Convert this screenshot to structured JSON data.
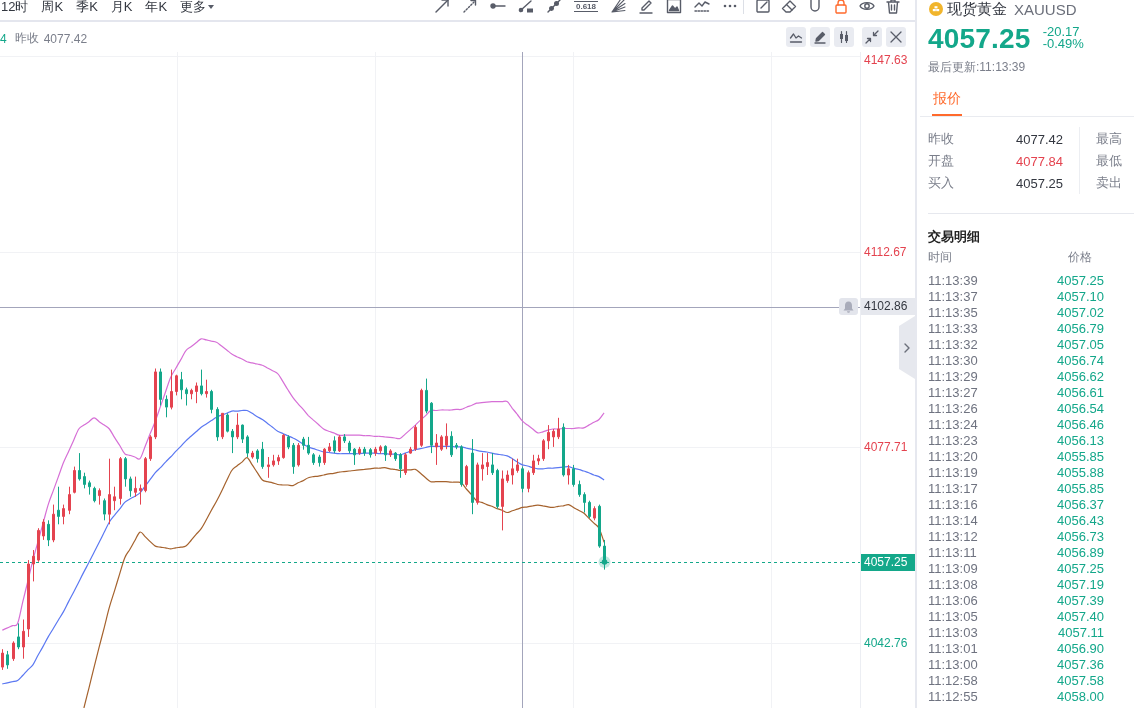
{
  "toolbar": {
    "intervals": [
      {
        "label": "12时",
        "selected": false,
        "kind": "interval"
      },
      {
        "label": "周K",
        "selected": false,
        "kind": "interval"
      },
      {
        "label": "季K",
        "selected": false,
        "kind": "interval"
      },
      {
        "label": "月K",
        "selected": false,
        "kind": "interval"
      },
      {
        "label": "年K",
        "selected": false,
        "kind": "interval"
      },
      {
        "label": "更多",
        "selected": false,
        "kind": "dropdown"
      }
    ],
    "fib_label": "0.618",
    "lock_on": true
  },
  "chart": {
    "legend": {
      "cut_value": "4",
      "prev_close_label": "昨收",
      "prev_close_value": "4077.42"
    },
    "chart_data": [
      {
        "type": "candlestick",
        "ylim": [
          4031.2,
          4148.3
        ],
        "yticks": [
          {
            "value": 4042.76,
            "label": "4042.76"
          },
          {
            "value": 4077.71,
            "label": "4077.71"
          },
          {
            "value": 4112.67,
            "label": "4112.67"
          },
          {
            "value": 4147.63,
            "label": "4147.63"
          }
        ],
        "tick_labels": "y",
        "grid": true,
        "categories": [
          null,
          null,
          null,
          null,
          null,
          null,
          null,
          null,
          null,
          null,
          null,
          null,
          null,
          null,
          null,
          null,
          null,
          null,
          null,
          null,
          null,
          null,
          null,
          null,
          null,
          null,
          null,
          null,
          null,
          null,
          null,
          null,
          null,
          null,
          null,
          null,
          null,
          null,
          null,
          null,
          null,
          null,
          null,
          null,
          null,
          null,
          null,
          null,
          null,
          null,
          null,
          null,
          null,
          null,
          null,
          null,
          null,
          null,
          null,
          null,
          null,
          null,
          null,
          null,
          null,
          null,
          null,
          null,
          null,
          null,
          null,
          null,
          null,
          null,
          null,
          null,
          null,
          null,
          null,
          null,
          null,
          null,
          null,
          null,
          null,
          null,
          null,
          null,
          null,
          null,
          null,
          null,
          null,
          null,
          null,
          null,
          null,
          null,
          null,
          null,
          null,
          null,
          null,
          null,
          null,
          null,
          null,
          null,
          null,
          null,
          null,
          null,
          null,
          null,
          null,
          null,
          null,
          null,
          null
        ],
        "ohlc": [
          [
            4038.5,
            4041.7,
            4038.0,
            4041.0
          ],
          [
            4040.7,
            4041.4,
            4038.2,
            4038.9
          ],
          [
            4040.0,
            4043.1,
            4039.6,
            4042.8
          ],
          [
            4043.9,
            4046.3,
            4041.7,
            4042.1
          ],
          [
            4042.1,
            4047.0,
            4040.0,
            4044.9
          ],
          [
            4045.3,
            4057.6,
            4043.9,
            4056.9
          ],
          [
            4056.9,
            4059.4,
            4053.8,
            4058.3
          ],
          [
            4057.6,
            4063.3,
            4057.3,
            4062.9
          ],
          [
            4061.9,
            4064.9,
            4061.2,
            4064.4
          ],
          [
            4064.0,
            4064.7,
            4060.1,
            4061.2
          ],
          [
            4061.2,
            4067.5,
            4060.8,
            4065.8
          ],
          [
            4066.5,
            4070.7,
            4064.0,
            4065.4
          ],
          [
            4065.4,
            4067.5,
            4064.0,
            4066.8
          ],
          [
            4066.5,
            4070.7,
            4065.8,
            4069.3
          ],
          [
            4069.7,
            4074.3,
            4069.5,
            4073.6
          ],
          [
            4073.6,
            4076.7,
            4071.8,
            4072.1
          ],
          [
            4072.5,
            4073.2,
            4070.4,
            4071.1
          ],
          [
            4071.4,
            4071.8,
            4069.3,
            4070.7
          ],
          [
            4070.4,
            4070.7,
            4067.9,
            4068.2
          ],
          [
            4069.1,
            4070.4,
            4067.5,
            4070.0
          ],
          [
            4068.2,
            4068.6,
            4064.7,
            4065.8
          ],
          [
            4065.8,
            4075.7,
            4064.0,
            4069.3
          ],
          [
            4068.2,
            4070.7,
            4066.5,
            4068.9
          ],
          [
            4068.6,
            4076.0,
            4067.5,
            4075.7
          ],
          [
            4075.7,
            4076.0,
            4070.7,
            4072.1
          ],
          [
            4072.1,
            4072.5,
            4068.9,
            4070.0
          ],
          [
            4069.7,
            4072.5,
            4068.9,
            4070.4
          ],
          [
            4070.0,
            4071.1,
            4067.5,
            4070.4
          ],
          [
            4070.0,
            4076.0,
            4069.7,
            4075.7
          ],
          [
            4075.7,
            4079.9,
            4075.3,
            4079.6
          ],
          [
            4079.6,
            4091.8,
            4079.2,
            4091.2
          ],
          [
            4091.2,
            4091.8,
            4085.2,
            4086.3
          ],
          [
            4086.3,
            4087.0,
            4083.1,
            4084.9
          ],
          [
            4084.9,
            4091.6,
            4084.5,
            4087.7
          ],
          [
            4087.7,
            4090.7,
            4087.0,
            4090.5
          ],
          [
            4089.8,
            4091.2,
            4086.3,
            4088.0
          ],
          [
            4088.0,
            4088.4,
            4085.2,
            4087.3
          ],
          [
            4087.3,
            4088.2,
            4086.3,
            4087.9
          ],
          [
            4087.7,
            4089.3,
            4085.6,
            4088.7
          ],
          [
            4088.7,
            4091.6,
            4087.0,
            4087.3
          ],
          [
            4087.3,
            4089.8,
            4086.6,
            4087.7
          ],
          [
            4087.7,
            4088.0,
            4083.8,
            4084.5
          ],
          [
            4084.5,
            4084.9,
            4078.9,
            4079.6
          ],
          [
            4079.6,
            4083.8,
            4079.2,
            4083.8
          ],
          [
            4083.5,
            4083.8,
            4080.4,
            4080.6
          ],
          [
            4080.6,
            4081.0,
            4076.7,
            4079.6
          ],
          [
            4079.6,
            4083.8,
            4079.2,
            4081.7
          ],
          [
            4081.7,
            4081.8,
            4078.5,
            4079.2
          ],
          [
            4079.6,
            4079.9,
            4076.0,
            4076.7
          ],
          [
            4076.0,
            4077.1,
            4075.7,
            4076.7
          ],
          [
            4077.1,
            4077.4,
            4075.0,
            4075.7
          ],
          [
            4077.4,
            4078.7,
            4073.9,
            4074.3
          ],
          [
            4074.3,
            4076.0,
            4072.3,
            4074.6
          ],
          [
            4074.6,
            4076.4,
            4074.3,
            4075.3
          ],
          [
            4075.3,
            4076.4,
            4074.6,
            4075.9
          ],
          [
            4075.9,
            4080.1,
            4075.7,
            4079.9
          ],
          [
            4079.6,
            4079.9,
            4077.4,
            4077.8
          ],
          [
            4078.1,
            4078.5,
            4073.0,
            4074.3
          ],
          [
            4074.6,
            4078.5,
            4074.3,
            4078.1
          ],
          [
            4079.2,
            4079.6,
            4077.3,
            4078.1
          ],
          [
            4078.1,
            4079.6,
            4076.4,
            4076.7
          ],
          [
            4076.4,
            4076.7,
            4074.6,
            4075.0
          ],
          [
            4076.0,
            4076.4,
            4074.3,
            4075.0
          ],
          [
            4075.0,
            4077.6,
            4074.6,
            4077.4
          ],
          [
            4077.1,
            4078.5,
            4076.9,
            4077.8
          ],
          [
            4078.9,
            4079.7,
            4076.7,
            4077.1
          ],
          [
            4077.1,
            4079.9,
            4076.9,
            4079.6
          ],
          [
            4079.6,
            4080.1,
            4078.5,
            4078.9
          ],
          [
            4078.5,
            4078.9,
            4076.7,
            4077.1
          ],
          [
            4077.4,
            4077.6,
            4074.6,
            4076.4
          ],
          [
            4076.7,
            4077.8,
            4076.4,
            4077.4
          ],
          [
            4077.4,
            4077.8,
            4076.2,
            4076.7
          ],
          [
            4077.3,
            4077.6,
            4075.9,
            4076.4
          ],
          [
            4076.7,
            4077.8,
            4076.2,
            4077.4
          ],
          [
            4077.1,
            4078.1,
            4076.6,
            4077.8
          ],
          [
            4077.9,
            4078.1,
            4075.3,
            4076.4
          ],
          [
            4076.4,
            4077.4,
            4076.0,
            4077.1
          ],
          [
            4076.7,
            4076.9,
            4075.3,
            4075.7
          ],
          [
            4076.4,
            4076.7,
            4072.3,
            4073.9
          ],
          [
            4073.2,
            4076.7,
            4072.8,
            4076.4
          ],
          [
            4076.7,
            4077.8,
            4076.6,
            4077.4
          ],
          [
            4077.4,
            4081.7,
            4077.1,
            4081.3
          ],
          [
            4078.1,
            4088.2,
            4077.8,
            4087.9
          ],
          [
            4087.9,
            4090.0,
            4083.8,
            4084.2
          ],
          [
            4085.6,
            4085.8,
            4076.7,
            4078.1
          ],
          [
            4077.8,
            4080.1,
            4074.6,
            4078.5
          ],
          [
            4077.4,
            4079.9,
            4077.1,
            4079.6
          ],
          [
            4078.1,
            4082.0,
            4077.4,
            4079.7
          ],
          [
            4079.7,
            4080.6,
            4076.0,
            4076.4
          ],
          [
            4078.1,
            4078.5,
            4077.4,
            4077.8
          ],
          [
            4077.8,
            4078.1,
            4070.7,
            4071.1
          ],
          [
            4071.1,
            4074.6,
            4070.7,
            4074.3
          ],
          [
            4076.7,
            4079.2,
            4065.8,
            4067.9
          ],
          [
            4067.9,
            4075.0,
            4067.5,
            4074.6
          ],
          [
            4073.9,
            4076.7,
            4071.8,
            4074.6
          ],
          [
            4074.3,
            4076.7,
            4072.8,
            4075.0
          ],
          [
            4074.6,
            4076.7,
            4072.8,
            4073.2
          ],
          [
            4073.6,
            4073.9,
            4066.8,
            4067.2
          ],
          [
            4067.2,
            4073.6,
            4062.9,
            4072.1
          ],
          [
            4071.8,
            4073.6,
            4071.4,
            4072.8
          ],
          [
            4072.8,
            4075.7,
            4071.1,
            4073.9
          ],
          [
            4073.6,
            4075.7,
            4073.2,
            4074.6
          ],
          [
            4073.9,
            4074.3,
            4069.7,
            4070.4
          ],
          [
            4070.4,
            4073.6,
            4069.7,
            4073.2
          ],
          [
            4073.2,
            4076.4,
            4072.8,
            4075.3
          ],
          [
            4075.3,
            4076.4,
            4074.6,
            4075.7
          ],
          [
            4075.7,
            4079.2,
            4075.3,
            4078.9
          ],
          [
            4078.9,
            4081.7,
            4077.4,
            4080.4
          ],
          [
            4079.6,
            4081.0,
            4077.8,
            4080.6
          ],
          [
            4079.6,
            4083.0,
            4079.2,
            4081.0
          ],
          [
            4081.3,
            4082.0,
            4072.5,
            4072.8
          ],
          [
            4072.8,
            4074.6,
            4071.1,
            4073.9
          ],
          [
            4073.9,
            4074.6,
            4070.7,
            4071.1
          ],
          [
            4071.1,
            4071.8,
            4068.9,
            4069.3
          ],
          [
            4069.3,
            4069.7,
            4066.1,
            4067.9
          ],
          [
            4067.9,
            4068.2,
            4065.1,
            4065.4
          ],
          [
            4065.1,
            4067.2,
            4064.7,
            4066.8
          ],
          [
            4067.2,
            4067.5,
            4059.8,
            4060.1
          ],
          [
            4060.1,
            4061.2,
            4055.9,
            4057.25
          ]
        ],
        "series": [
          {
            "type": "line",
            "color": "#d66fd6",
            "values": [
              4045.1,
              4045.5,
              4045.9,
              4046.3,
              4050.1,
              4053.8,
              4057.6,
              4060.9,
              4064.2,
              4067.5,
              4070.0,
              4072.5,
              4075.0,
              4077.0,
              4079.0,
              4081.0,
              4081.7,
              4082.3,
              4083.0,
              4082.3,
              4081.7,
              4081.0,
              4079.5,
              4078.1,
              4076.6,
              4076.3,
              4076.0,
              4075.7,
              4077.9,
              4080.2,
              4082.4,
              4085.0,
              4087.6,
              4090.2,
              4091.8,
              4093.4,
              4095.0,
              4095.7,
              4096.4,
              4097.1,
              4096.9,
              4096.7,
              4096.5,
              4095.8,
              4095.1,
              4094.4,
              4093.9,
              4093.5,
              4093.0,
              4092.8,
              4092.6,
              4092.4,
              4091.9,
              4091.4,
              4090.9,
              4089.5,
              4088.0,
              4086.6,
              4085.5,
              4084.5,
              4083.4,
              4082.6,
              4081.8,
              4081.0,
              4080.6,
              4080.3,
              4079.9,
              4079.9,
              4079.9,
              4079.9,
              4079.9,
              4079.8,
              4079.8,
              4079.7,
              4079.7,
              4079.6,
              4079.5,
              4079.4,
              4079.3,
              4080.1,
              4080.9,
              4081.7,
              4082.6,
              4083.4,
              4084.3,
              4084.3,
              4084.4,
              4084.4,
              4084.4,
              4084.5,
              4084.5,
              4084.9,
              4085.2,
              4085.6,
              4085.7,
              4085.8,
              4085.9,
              4085.9,
              4085.9,
              4085.9,
              4084.7,
              4083.6,
              4082.4,
              4081.7,
              4081.0,
              4080.3,
              4080.5,
              4080.8,
              4081.0,
              4081.0,
              4081.1,
              4081.1,
              4081.1,
              4081.2,
              4081.2,
              4081.7,
              4082.2,
              4082.7,
              4083.9
            ]
          },
          {
            "type": "line",
            "color": "#5b78f2",
            "values": [
              4035.5,
              4035.7,
              4035.9,
              4036.1,
              4037.0,
              4038.0,
              4038.9,
              4040.6,
              4042.2,
              4043.9,
              4045.4,
              4046.9,
              4048.4,
              4050.2,
              4051.9,
              4053.7,
              4055.5,
              4057.2,
              4059.0,
              4060.8,
              4062.6,
              4064.4,
              4065.6,
              4066.7,
              4067.9,
              4068.5,
              4069.0,
              4069.6,
              4070.8,
              4072.0,
              4073.2,
              4074.1,
              4075.1,
              4076.0,
              4077.0,
              4077.9,
              4078.9,
              4079.7,
              4080.5,
              4081.3,
              4081.9,
              4082.5,
              4083.1,
              4083.5,
              4083.8,
              4084.2,
              4084.2,
              4084.3,
              4084.3,
              4083.8,
              4083.2,
              4082.7,
              4082.0,
              4081.3,
              4080.6,
              4080.2,
              4079.8,
              4079.4,
              4078.9,
              4078.3,
              4077.8,
              4077.5,
              4077.2,
              4076.9,
              4076.8,
              4076.7,
              4076.6,
              4076.6,
              4076.6,
              4076.6,
              4076.6,
              4076.7,
              4076.7,
              4076.7,
              4076.6,
              4076.6,
              4076.5,
              4076.5,
              4076.4,
              4076.7,
              4077.0,
              4077.3,
              4077.5,
              4077.7,
              4077.9,
              4077.9,
              4077.9,
              4077.9,
              4077.9,
              4077.8,
              4077.8,
              4077.6,
              4077.4,
              4077.2,
              4077.0,
              4076.9,
              4076.7,
              4076.5,
              4076.4,
              4076.2,
              4075.7,
              4075.1,
              4074.6,
              4074.4,
              4074.1,
              4073.9,
              4073.9,
              4074.0,
              4074.0,
              4074.1,
              4074.2,
              4074.3,
              4074.0,
              4073.8,
              4073.5,
              4073.2,
              4072.8,
              4072.5,
              4071.9
            ]
          },
          {
            "type": "line",
            "color": "#a5622d",
            "values": [
              null,
              null,
              null,
              null,
              null,
              null,
              null,
              null,
              null,
              null,
              null,
              null,
              null,
              null,
              null,
              null,
              4031.2,
              4034.8,
              4038.5,
              4042.1,
              4045.6,
              4049.2,
              4052.1,
              4055.1,
              4058.0,
              4059.5,
              4061.1,
              4062.6,
              4061.8,
              4060.9,
              4060.1,
              4059.9,
              4059.8,
              4059.6,
              4059.8,
              4059.9,
              4060.1,
              4061.1,
              4062.2,
              4063.2,
              4064.8,
              4066.5,
              4068.1,
              4069.9,
              4071.8,
              4073.6,
              4074.4,
              4075.1,
              4075.9,
              4074.6,
              4073.2,
              4071.9,
              4071.6,
              4071.4,
              4071.1,
              4071.0,
              4071.0,
              4070.9,
              4071.4,
              4071.8,
              4072.3,
              4072.5,
              4072.6,
              4072.8,
              4073.0,
              4073.1,
              4073.3,
              4073.4,
              4073.5,
              4073.6,
              4073.7,
              4073.8,
              4073.9,
              4074.0,
              4074.0,
              4074.1,
              4073.9,
              4073.8,
              4073.6,
              4073.7,
              4073.7,
              4073.8,
              4073.1,
              4072.3,
              4071.6,
              4071.6,
              4071.6,
              4071.6,
              4071.5,
              4071.5,
              4071.4,
              4070.3,
              4069.3,
              4068.2,
              4067.9,
              4067.5,
              4067.2,
              4066.8,
              4066.5,
              4066.1,
              4066.4,
              4066.7,
              4067.0,
              4067.1,
              4067.3,
              4067.4,
              4067.3,
              4067.1,
              4067.0,
              4067.2,
              4067.3,
              4067.5,
              4067.0,
              4066.5,
              4066.0,
              4065.1,
              4064.2,
              4063.3,
              4060.8
            ]
          }
        ],
        "ref_lines": [
          {
            "axis": "y",
            "value": 4102.86,
            "label": "4102.86",
            "color": "#a3a5bb",
            "line_style": "solid"
          },
          {
            "axis": "y",
            "value": 4057.25,
            "label": "4057.25",
            "color": "#14a88a",
            "line_style": "dashed"
          }
        ]
      }
    ]
  },
  "quote_panel": {
    "name": "现货黄金",
    "symbol": "XAUUSD",
    "price": "4057.25",
    "change": "-20.17",
    "change_pct": "-0.49%",
    "updated": "最后更新:11:13:39",
    "tabs": [
      {
        "label": "报价",
        "selected": true
      }
    ],
    "quote_left": [
      {
        "label": "昨收",
        "value": "4077.42",
        "color": "#333740"
      },
      {
        "label": "开盘",
        "value": "4077.84",
        "color": "#e4434f"
      },
      {
        "label": "买入",
        "value": "4057.25",
        "color": "#333740"
      }
    ],
    "quote_right": [
      {
        "label": "最高"
      },
      {
        "label": "最低"
      },
      {
        "label": "卖出"
      }
    ]
  },
  "trades": {
    "title": "交易明细",
    "columns": [
      "时间",
      "价格"
    ],
    "rows": [
      {
        "time": "11:13:39",
        "price": "4057.25"
      },
      {
        "time": "11:13:37",
        "price": "4057.10"
      },
      {
        "time": "11:13:35",
        "price": "4057.02"
      },
      {
        "time": "11:13:33",
        "price": "4056.79"
      },
      {
        "time": "11:13:32",
        "price": "4057.05"
      },
      {
        "time": "11:13:30",
        "price": "4056.74"
      },
      {
        "time": "11:13:29",
        "price": "4056.62"
      },
      {
        "time": "11:13:27",
        "price": "4056.61"
      },
      {
        "time": "11:13:26",
        "price": "4056.54"
      },
      {
        "time": "11:13:24",
        "price": "4056.46"
      },
      {
        "time": "11:13:23",
        "price": "4056.13"
      },
      {
        "time": "11:13:20",
        "price": "4055.85"
      },
      {
        "time": "11:13:19",
        "price": "4055.88"
      },
      {
        "time": "11:13:17",
        "price": "4055.85"
      },
      {
        "time": "11:13:16",
        "price": "4056.37"
      },
      {
        "time": "11:13:14",
        "price": "4056.43"
      },
      {
        "time": "11:13:12",
        "price": "4056.73"
      },
      {
        "time": "11:13:11",
        "price": "4056.89"
      },
      {
        "time": "11:13:09",
        "price": "4057.25"
      },
      {
        "time": "11:13:08",
        "price": "4057.19"
      },
      {
        "time": "11:13:06",
        "price": "4057.39"
      },
      {
        "time": "11:13:05",
        "price": "4057.40"
      },
      {
        "time": "11:13:03",
        "price": "4057.11"
      },
      {
        "time": "11:13:01",
        "price": "4056.90"
      },
      {
        "time": "11:13:00",
        "price": "4057.36"
      },
      {
        "time": "11:12:58",
        "price": "4057.58"
      },
      {
        "time": "11:12:55",
        "price": "4058.00"
      }
    ]
  }
}
